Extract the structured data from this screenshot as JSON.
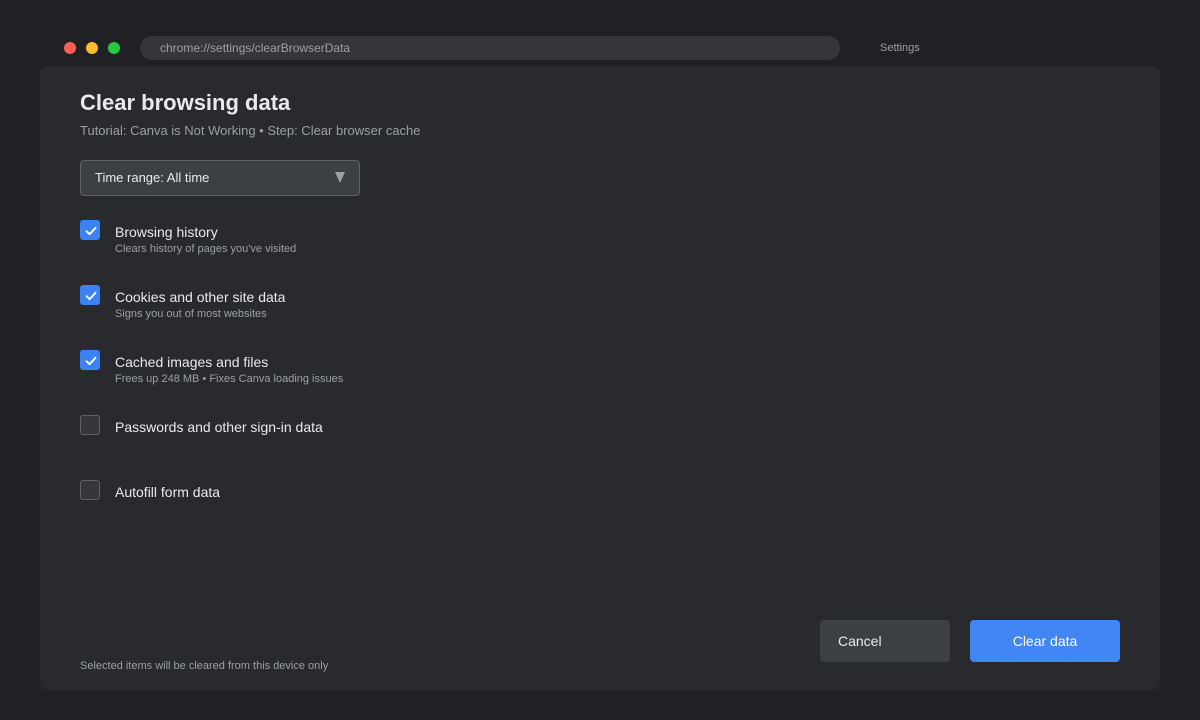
{
  "window": {
    "url": "chrome://settings/clearBrowserData",
    "tab_label": "Settings"
  },
  "dialog": {
    "title": "Clear browsing data",
    "subtitle": "Tutorial: Canva is Not Working • Step: Clear browser cache",
    "time_range": {
      "label": "Time range: All time",
      "selected": "All time"
    },
    "options": [
      {
        "label": "Browsing history",
        "description": "Clears history of pages you've visited",
        "checked": true
      },
      {
        "label": "Cookies and other site data",
        "description": "Signs you out of most websites",
        "checked": true
      },
      {
        "label": "Cached images and files",
        "description": "Frees up 248 MB • Fixes Canva loading issues",
        "checked": true
      },
      {
        "label": "Passwords and other sign-in data",
        "description": "",
        "checked": false
      },
      {
        "label": "Autofill form data",
        "description": "",
        "checked": false
      }
    ],
    "footer_note": "Selected items will be cleared from this device only",
    "buttons": {
      "cancel": "Cancel",
      "clear": "Clear data"
    }
  },
  "colors": {
    "background": "#202124",
    "panel": "#292a2d",
    "accent": "#4285f4",
    "checkbox_checked": "#3b82f6"
  }
}
